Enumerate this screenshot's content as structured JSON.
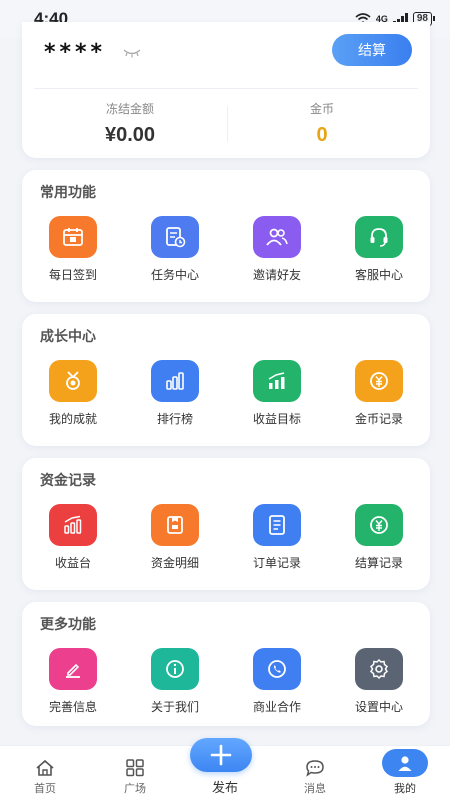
{
  "status_bar": {
    "time": "4:40",
    "signal": "4G",
    "battery": "98"
  },
  "wallet": {
    "masked_balance": "****",
    "settle_label": "结算",
    "frozen_label": "冻结金额",
    "frozen_value": "¥0.00",
    "coins_label": "金币",
    "coins_value": "0"
  },
  "sections": [
    {
      "title": "常用功能",
      "items": [
        {
          "label": "每日签到",
          "icon": "calendar-icon",
          "color": "#f77a2c"
        },
        {
          "label": "任务中心",
          "icon": "task-clock-icon",
          "color": "#4e7cf0"
        },
        {
          "label": "邀请好友",
          "icon": "users-icon",
          "color": "#8a5cf0"
        },
        {
          "label": "客服中心",
          "icon": "headset-icon",
          "color": "#23b36b"
        }
      ]
    },
    {
      "title": "成长中心",
      "items": [
        {
          "label": "我的成就",
          "icon": "medal-icon",
          "color": "#f4a21c"
        },
        {
          "label": "排行榜",
          "icon": "bars-icon",
          "color": "#3f7ff2"
        },
        {
          "label": "收益目标",
          "icon": "growth-chart-icon",
          "color": "#23b36b"
        },
        {
          "label": "金币记录",
          "icon": "coin-icon",
          "color": "#f4a21c"
        }
      ]
    },
    {
      "title": "资金记录",
      "items": [
        {
          "label": "收益台",
          "icon": "growth-chart-icon",
          "color": "#ec3f3f"
        },
        {
          "label": "资金明细",
          "icon": "wallet-detail-icon",
          "color": "#f77a2c"
        },
        {
          "label": "订单记录",
          "icon": "document-icon",
          "color": "#3f7ff2"
        },
        {
          "label": "结算记录",
          "icon": "yuan-icon",
          "color": "#23b36b"
        }
      ]
    },
    {
      "title": "更多功能",
      "items": [
        {
          "label": "完善信息",
          "icon": "edit-icon",
          "color": "#ec3f8e"
        },
        {
          "label": "关于我们",
          "icon": "info-icon",
          "color": "#1fb79a"
        },
        {
          "label": "商业合作",
          "icon": "phone-icon",
          "color": "#3f7ff2"
        },
        {
          "label": "设置中心",
          "icon": "gear-icon",
          "color": "#5b6472"
        }
      ]
    }
  ],
  "bottom_nav": [
    {
      "label": "首页",
      "icon": "home-icon"
    },
    {
      "label": "广场",
      "icon": "grid-icon"
    },
    {
      "label": "发布",
      "icon": "plus-icon"
    },
    {
      "label": "消息",
      "icon": "chat-icon"
    },
    {
      "label": "我的",
      "icon": "user-icon"
    }
  ]
}
